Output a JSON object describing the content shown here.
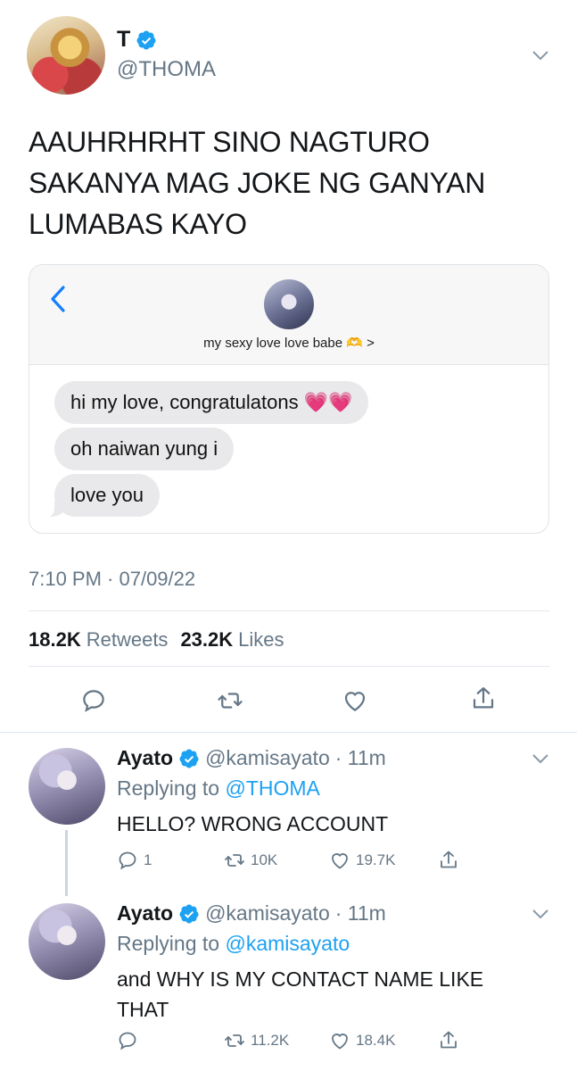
{
  "main_tweet": {
    "author_name": "T",
    "author_handle": "@THOMA",
    "text": "AAUHRHRHT SINO NAGTURO SAKANYA MAG JOKE NG GANYAN LUMABAS KAYO",
    "timestamp": "7:10 PM · 07/09/22",
    "retweets_count": "18.2K",
    "retweets_label": "Retweets",
    "likes_count": "23.2K",
    "likes_label": "Likes"
  },
  "embedded_image": {
    "contact_name": "my sexy love love babe 🫶 >",
    "messages": [
      "hi my love, congratulatons 💗💗",
      "oh naiwan yung i",
      "love you"
    ]
  },
  "replies": [
    {
      "author_name": "Ayato",
      "author_handle": "@kamisayato",
      "time": "· 11m",
      "replying_prefix": "Replying to",
      "replying_to": "@THOMA",
      "text": "HELLO? WRONG ACCOUNT",
      "reply_count": "1",
      "retweet_count": "10K",
      "like_count": "19.7K"
    },
    {
      "author_name": "Ayato",
      "author_handle": "@kamisayato",
      "time": "· 11m",
      "replying_prefix": "Replying to",
      "replying_to": "@kamisayato",
      "text": "and WHY IS MY CONTACT NAME LIKE THAT",
      "reply_count": "",
      "retweet_count": "11.2K",
      "like_count": "18.4K"
    }
  ],
  "colors": {
    "accent": "#1da1f2",
    "secondary_text": "#657786",
    "bubble": "#e9e9eb"
  }
}
